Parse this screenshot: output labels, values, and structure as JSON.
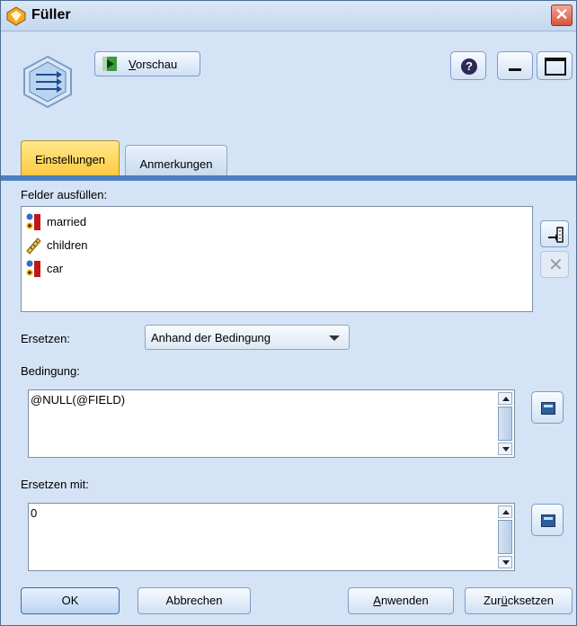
{
  "window": {
    "title": "Füller"
  },
  "toolbar": {
    "preview_label_prefix": "",
    "preview_label_underlined": "V",
    "preview_label_rest": "orschau"
  },
  "tabs": [
    {
      "label": "Einstellungen",
      "active": true
    },
    {
      "label": "Anmerkungen",
      "active": false
    }
  ],
  "settings": {
    "fields_label": "Felder ausfüllen:",
    "fields": [
      {
        "name": "married",
        "icon": "flag-measure-icon"
      },
      {
        "name": "children",
        "icon": "ruler-continuous-icon"
      },
      {
        "name": "car",
        "icon": "flag-measure-icon"
      }
    ],
    "replace_label": "Ersetzen:",
    "replace_value": "Anhand der Bedingung",
    "condition_label": "Bedingung:",
    "condition_value": "@NULL(@FIELD)",
    "replace_with_label": "Ersetzen mit:",
    "replace_with_value": "0"
  },
  "footer": {
    "ok": "OK",
    "cancel": "Abbrechen",
    "apply_underlined": "A",
    "apply_rest": "nwenden",
    "reset_prefix": "Zur",
    "reset_underlined": "ü",
    "reset_rest": "cksetzen"
  },
  "colors": {
    "background": "#d4e3f5",
    "active_tab": "#ffc941",
    "tab_line": "#4d7fbf",
    "close": "#d9513c"
  }
}
